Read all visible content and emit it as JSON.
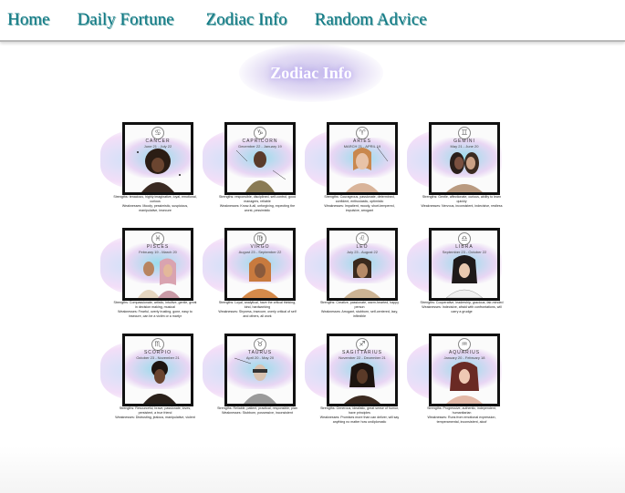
{
  "nav": {
    "items": [
      "Home",
      "Daily Fortune",
      "Zodiac Info",
      "Random Advice"
    ]
  },
  "page": {
    "title": "Zodiac Info"
  },
  "colors": {
    "nav_link": "#127a86",
    "title_glow": "#c9b8ff"
  },
  "cards": [
    {
      "sign": "CANCER",
      "dates": "June 21 - July 22",
      "strengths": "Strengths: tenacious, highly imaginative, loyal, emotional, curious",
      "weaknesses": "Weaknesses: Moody, pessimistic, suspicious, manipulative, insecure"
    },
    {
      "sign": "CAPRICORN",
      "dates": "December 22 - January 19",
      "strengths": "Strengths: responsible, disciplined, self-control, good managers, reliable",
      "weaknesses": "Weaknesses: Know-it-all, unforgiving, expecting the worst, pessimistic"
    },
    {
      "sign": "ARIES",
      "dates": "MARCH 21 - APRIL 19",
      "strengths": "Strengths: Courageous, passionate, determined, confident, enthusiastic, optimistic",
      "weaknesses": "Weaknesses: Impatient, moody, short-tempered, impulsive, arrogant"
    },
    {
      "sign": "GEMINI",
      "dates": "May 21 - June 20",
      "strengths": "Strengths: Gentle, affectionate, curious, ability to learn quickly",
      "weaknesses": "Weaknesses: Nervous, inconsistent, indecisive, restless"
    },
    {
      "sign": "PISCES",
      "dates": "February 19 - March 20",
      "strengths": "Strengths: Compassionate, artistic, intuitive, gentle, great in decision making, musical",
      "weaknesses": "Weaknesses: Fearful, overly trusting, gone, easy to insecure, can be a victim or a martyr"
    },
    {
      "sign": "VIRGO",
      "dates": "August 23 - September 22",
      "strengths": "Strengths: Loyal, analytical, have the critical thinking, kind, hardworking",
      "weaknesses": "Weaknesses: Shyness, insecure, overly critical of self and others, all work"
    },
    {
      "sign": "LEO",
      "dates": "July 23 - August 22",
      "strengths": "Strengths: Creative, passionate, warm-hearted, happy person",
      "weaknesses": "Weaknesses: Arrogant, stubborn, self-centered, lazy, inflexible"
    },
    {
      "sign": "LIBRA",
      "dates": "September 23 - October 22",
      "strengths": "Strengths: Cooperative, leadership, gracious, fair-minded",
      "weaknesses": "Weaknesses: Indecisive, afraid with confrontations, will carry a grudge"
    },
    {
      "sign": "SCORPIO",
      "dates": "October 23 - November 21",
      "strengths": "Strengths: Resourceful, brave, passionate, loves, persistent, a true friend",
      "weaknesses": "Weaknesses: Distrusting, jealous, manipulative, violent"
    },
    {
      "sign": "TAURUS",
      "dates": "April 20 - May 20",
      "strengths": "Strengths: Reliable, patient, practical, responsible, plan",
      "weaknesses": "Weaknesses: Stubborn, possessive, inconsistent"
    },
    {
      "sign": "SAGITTARIUS",
      "dates": "November 22 - December 21",
      "strengths": "Strengths: Generous, idealistic, great sense of humor, have principles",
      "weaknesses": "Weaknesses: Promises more than can deliver, will say anything no matter how undiplomatic"
    },
    {
      "sign": "AQUARIUS",
      "dates": "January 20 - February 18",
      "strengths": "Strengths: Progressive, authentic, independent, humanitarian",
      "weaknesses": "Weaknesses: Runs from emotional expression, temperamental, inconsistent, aloof"
    }
  ]
}
